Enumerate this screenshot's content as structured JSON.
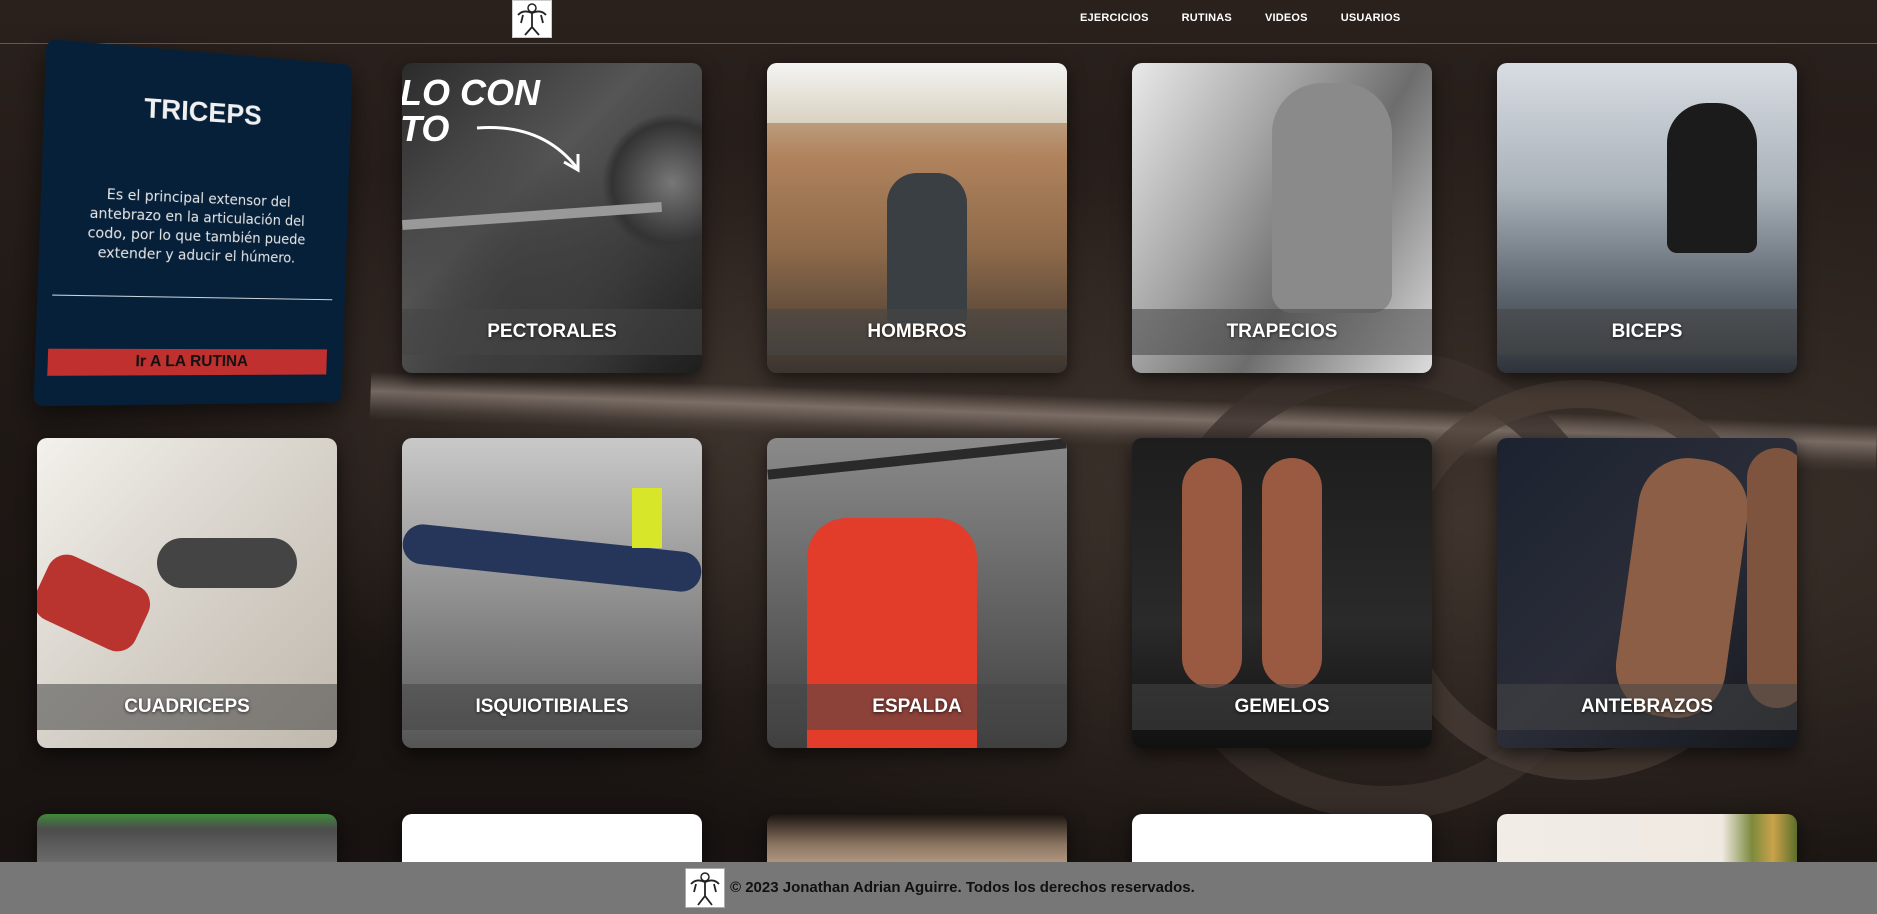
{
  "nav": {
    "items": [
      {
        "label": "EJERCICIOS"
      },
      {
        "label": "RUTINAS"
      },
      {
        "label": "VIDEOS"
      },
      {
        "label": "USUARIOS"
      }
    ]
  },
  "info_card": {
    "title": "TRICEPS",
    "description": "Es el principal extensor del antebrazo en la articulación del codo, por lo que también puede extender y aducir el húmero.",
    "button_label": "Ir A LA RUTINA"
  },
  "tiles": [
    {
      "label": "PECTORALES",
      "overlay_text": "LO CON\nTO"
    },
    {
      "label": "HOMBROS"
    },
    {
      "label": "TRAPECIOS"
    },
    {
      "label": "BICEPS"
    },
    {
      "label": "CUADRICEPS"
    },
    {
      "label": "ISQUIOTIBIALES"
    },
    {
      "label": "ESPALDA"
    },
    {
      "label": "GEMELOS"
    },
    {
      "label": "ANTEBRAZOS"
    }
  ],
  "footer": {
    "text": "© 2023 Jonathan Adrian Aguirre. Todos los derechos reservados."
  },
  "colors": {
    "card_bg": "#062039",
    "button_red": "#c0302e",
    "footer_bg": "#777777"
  }
}
